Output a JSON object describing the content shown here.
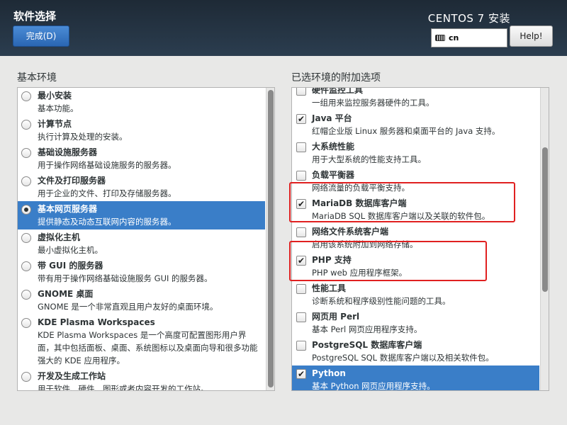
{
  "header": {
    "spoke_title": "软件选择",
    "done_label": "完成(D)",
    "product_title": "CENTOS 7 安装",
    "keyboard_layout": "cn",
    "help_label": "Help!"
  },
  "base_env": {
    "heading": "基本环境",
    "items": [
      {
        "title": "最小安装",
        "desc": "基本功能。",
        "selected": false
      },
      {
        "title": "计算节点",
        "desc": "执行计算及处理的安装。",
        "selected": false
      },
      {
        "title": "基础设施服务器",
        "desc": "用于操作网络基础设施服务的服务器。",
        "selected": false
      },
      {
        "title": "文件及打印服务器",
        "desc": "用于企业的文件、打印及存储服务器。",
        "selected": false
      },
      {
        "title": "基本网页服务器",
        "desc": "提供静态及动态互联网内容的服务器。",
        "selected": true
      },
      {
        "title": "虚拟化主机",
        "desc": "最小虚拟化主机。",
        "selected": false
      },
      {
        "title": "带 GUI 的服务器",
        "desc": "带有用于操作网络基础设施服务 GUI 的服务器。",
        "selected": false
      },
      {
        "title": "GNOME 桌面",
        "desc": "GNOME 是一个非常直观且用户友好的桌面环境。",
        "selected": false
      },
      {
        "title": "KDE Plasma Workspaces",
        "desc": "KDE Plasma Workspaces 是一个高度可配置图形用户界面，其中包括面板、桌面、系统图标以及桌面向导和很多功能强大的 KDE 应用程序。",
        "selected": false
      },
      {
        "title": "开发及生成工作站",
        "desc": "用于软件、硬件、图形或者内容开发的工作站。",
        "selected": false
      }
    ]
  },
  "addons": {
    "heading": "已选环境的附加选项",
    "items": [
      {
        "title": "硬件监控工具",
        "desc": "一组用来监控服务器硬件的工具。",
        "checked": false
      },
      {
        "title": "Java 平台",
        "desc": "红帽企业版 Linux 服务器和桌面平台的 Java 支持。",
        "checked": true
      },
      {
        "title": "大系统性能",
        "desc": "用于大型系统的性能支持工具。",
        "checked": false
      },
      {
        "title": "负载平衡器",
        "desc": "网络流量的负载平衡支持。",
        "checked": false
      },
      {
        "title": "MariaDB 数据库客户端",
        "desc": "MariaDB SQL 数据库客户端以及关联的软件包。",
        "checked": true
      },
      {
        "title": "网络文件系统客户端",
        "desc": "启用该系统附加到网络存储。",
        "checked": false
      },
      {
        "title": "PHP 支持",
        "desc": "PHP web 应用程序框架。",
        "checked": true
      },
      {
        "title": "性能工具",
        "desc": "诊断系统和程序级别性能问题的工具。",
        "checked": false
      },
      {
        "title": "网页用 Perl",
        "desc": "基本 Perl 网页应用程序支持。",
        "checked": false
      },
      {
        "title": "PostgreSQL 数据库客户端",
        "desc": "PostgreSQL SQL 数据库客户端以及相关软件包。",
        "checked": false
      },
      {
        "title": "Python",
        "desc": "基本 Python 网页应用程序支持。",
        "checked": true,
        "selected": true
      }
    ]
  },
  "colors": {
    "header_bg": "#1e2a36",
    "selection": "#3a7ec8",
    "annotation": "#e02020"
  }
}
